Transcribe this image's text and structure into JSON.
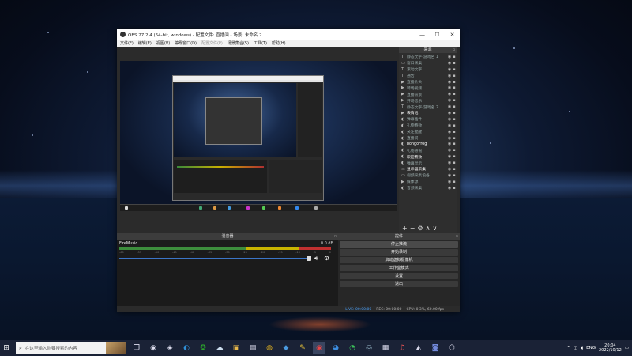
{
  "window": {
    "title": "OBS 27.2.4 (64-bit, windows) - 配置文件: 直播间 - 场景: 未命名 2",
    "minimize": "—",
    "maximize": "☐",
    "close": "✕"
  },
  "menu": [
    {
      "label": "文件(F)"
    },
    {
      "label": "编辑(E)"
    },
    {
      "label": "视图(V)"
    },
    {
      "label": "停靠窗口(D)"
    },
    {
      "label": "配置文件(P)",
      "disabled": true
    },
    {
      "label": "场景集合(S)"
    },
    {
      "label": "工具(T)"
    },
    {
      "label": "帮助(H)"
    }
  ],
  "sources": {
    "title": "来源",
    "items": [
      {
        "icon": "T",
        "name": "静态文字-游戏名 1",
        "visible": true
      },
      {
        "icon": "▭",
        "name": "窗口采集",
        "visible": true
      },
      {
        "icon": "T",
        "name": "滚动文字",
        "visible": true
      },
      {
        "icon": "T",
        "name": "通告",
        "visible": true
      },
      {
        "icon": "▶",
        "name": "直播片头",
        "visible": true
      },
      {
        "icon": "▶",
        "name": "转场视频",
        "visible": true
      },
      {
        "icon": "▶",
        "name": "直播背景",
        "visible": true
      },
      {
        "icon": "▶",
        "name": "开场音乐",
        "visible": true
      },
      {
        "icon": "T",
        "name": "静态文字-游戏名 2",
        "visible": true
      },
      {
        "icon": "▶",
        "name": "表情包",
        "visible": true,
        "active": true
      },
      {
        "icon": "◐",
        "name": "弹幕插件",
        "visible": true
      },
      {
        "icon": "◐",
        "name": "礼物特效",
        "visible": true
      },
      {
        "icon": "◐",
        "name": "关注提醒",
        "visible": true
      },
      {
        "icon": "◐",
        "name": "直播间",
        "visible": true
      },
      {
        "icon": "◐",
        "name": "bongoFrog",
        "visible": true,
        "active": true
      },
      {
        "icon": "◐",
        "name": "礼物感谢",
        "visible": true
      },
      {
        "icon": "◐",
        "name": "欢迎特效",
        "visible": true,
        "active": true
      },
      {
        "icon": "◐",
        "name": "弹幕显示",
        "visible": true
      },
      {
        "icon": "▭",
        "name": "显示器采集",
        "visible": true,
        "active": true
      },
      {
        "icon": "▭",
        "name": "视频采集设备",
        "visible": true
      },
      {
        "icon": "▶",
        "name": "媒体源",
        "visible": true
      },
      {
        "icon": "◐",
        "name": "音频采集",
        "visible": true
      }
    ],
    "tools": [
      "+",
      "−",
      "⚙",
      "∧",
      "∨"
    ]
  },
  "mixer": {
    "title": "混音器",
    "track_name": "FireMusic",
    "db_value": "0.0 dB",
    "scale": [
      "-60",
      "-55",
      "-50",
      "-45",
      "-40",
      "-35",
      "-30",
      "-25",
      "-20",
      "-15",
      "-10",
      "-5",
      "0"
    ]
  },
  "controls": {
    "title": "控件",
    "buttons": [
      {
        "label": "停止推流",
        "primary": true
      },
      {
        "label": "开始录制"
      },
      {
        "label": "启动虚拟摄像机"
      },
      {
        "label": "工作室模式"
      },
      {
        "label": "设置"
      },
      {
        "label": "退出"
      }
    ]
  },
  "status": {
    "live": "LIVE: 00:00:00",
    "rec": "REC: 00:00:00",
    "cpu": "CPU: 0.3%, 60.00 fps"
  },
  "taskbar": {
    "search_placeholder": "在这里输入你要搜索的内容",
    "apps": [
      "task-view",
      "obs",
      "media",
      "edge",
      "xbox",
      "cloud",
      "files",
      "explorer",
      "chrome",
      "store",
      "notes",
      "obs-active",
      "wechat-work",
      "wechat",
      "steam",
      "bilibili",
      "music",
      "app",
      "discord",
      "network"
    ],
    "tray": {
      "lang": "ENG",
      "time": "20:04",
      "date": "2022/10/12"
    }
  },
  "colors": {
    "live_accent": "#4aa3ff",
    "meter_green": "#3c8d3c",
    "meter_yellow": "#c8b400",
    "meter_red": "#c03030",
    "slider_blue": "#3b75c8"
  }
}
